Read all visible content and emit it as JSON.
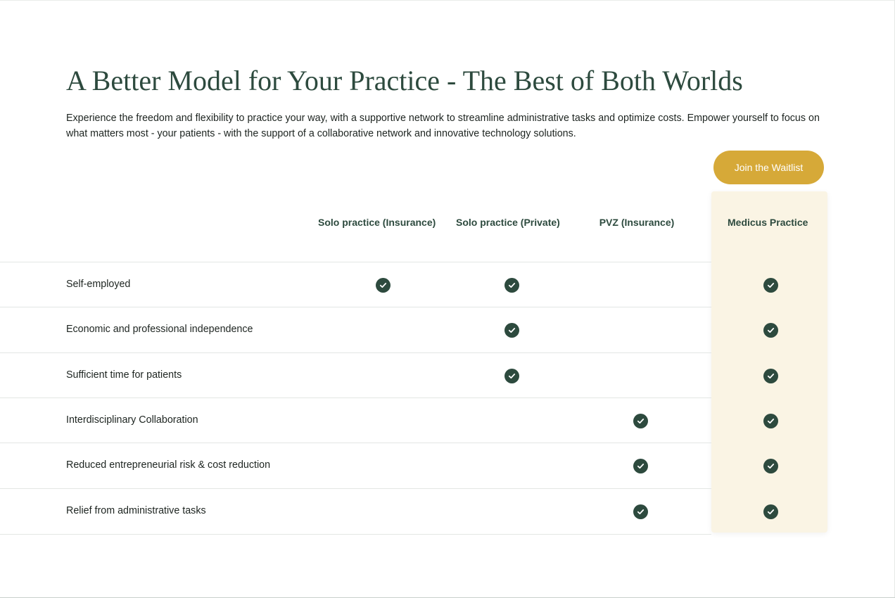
{
  "section": {
    "title": "A Better Model for Your Practice - The Best of Both Worlds",
    "intro": "Experience the freedom and flexibility to practice your way, with a supportive network to streamline administrative tasks and optimize costs. Empower yourself to focus on what matters most - your patients - with the support of a collaborative network and innovative technology solutions.",
    "cta_label": "Join the Waitlist"
  },
  "colors": {
    "accent_gold": "#d6a938",
    "dark_green": "#2d4a3e",
    "highlight_column_bg": "#faf4e4"
  },
  "table": {
    "columns": [
      "Solo practice (Insurance)",
      "Solo practice (Private)",
      "PVZ (Insurance)",
      "Medicus Practice"
    ],
    "check_icon": "check-circle-icon",
    "rows": [
      {
        "label": "Self-employed",
        "checks": [
          true,
          true,
          false,
          true
        ]
      },
      {
        "label": "Economic and professional independence",
        "checks": [
          false,
          true,
          false,
          true
        ]
      },
      {
        "label": "Sufficient time for patients",
        "checks": [
          false,
          true,
          false,
          true
        ]
      },
      {
        "label": "Interdisciplinary Collaboration",
        "checks": [
          false,
          false,
          true,
          true
        ]
      },
      {
        "label": "Reduced entrepreneurial risk & cost reduction",
        "checks": [
          false,
          false,
          true,
          true
        ]
      },
      {
        "label": "Relief from administrative tasks",
        "checks": [
          false,
          false,
          true,
          true
        ]
      }
    ]
  }
}
